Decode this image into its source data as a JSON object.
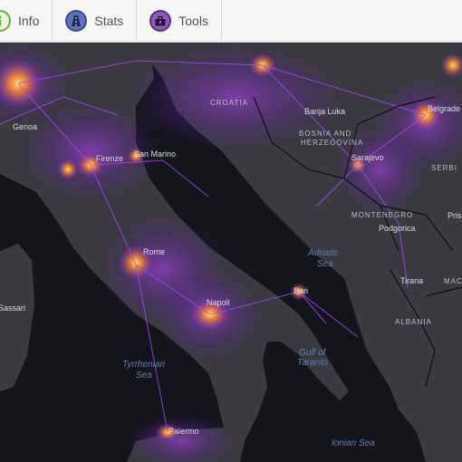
{
  "toolbar": {
    "tabs": [
      {
        "label": "Info",
        "icon": "info-icon",
        "icon_color": "#7bc24a"
      },
      {
        "label": "Stats",
        "icon": "road-icon",
        "icon_color": "#4a5fa8"
      },
      {
        "label": "Tools",
        "icon": "toolbox-icon",
        "icon_color": "#7b3fa0"
      }
    ]
  },
  "map": {
    "theme_colors": {
      "land": "#3b3a40",
      "sea": "#15161c",
      "glow": "#8a2be2",
      "hot": "#ffd54a"
    },
    "cities": {
      "genoa": "Genoa",
      "florence": "Firenze",
      "sanmarino": "San Marino",
      "rome": "Rome",
      "sassari": "Sassari",
      "palermo": "Palermo",
      "napoli": "Napoli",
      "bari": "Bari",
      "taranto_gulf": "Gulf of\nTaranto",
      "banjaluka": "Banja Luka",
      "sarajevo": "Sarajevo",
      "belgrade": "Belgrade",
      "podgorica": "Podgorica",
      "tirana": "Tirana",
      "pristina": "Pris"
    },
    "regions": {
      "bosnia": "BOSNIA AND\nHERZEGOVINA",
      "montenegro": "MONTENEGRO",
      "albania": "ALBANIA",
      "serbia": "SERBI",
      "macedonia": "MAC",
      "croatia": "CROATIA"
    },
    "seas": {
      "adriatic_1": "Adriatic",
      "adriatic_2": "Sea",
      "tyrrhenian_1": "Tyrrhenian",
      "tyrrhenian_2": "Sea",
      "ionian": "Ionian Sea"
    }
  }
}
